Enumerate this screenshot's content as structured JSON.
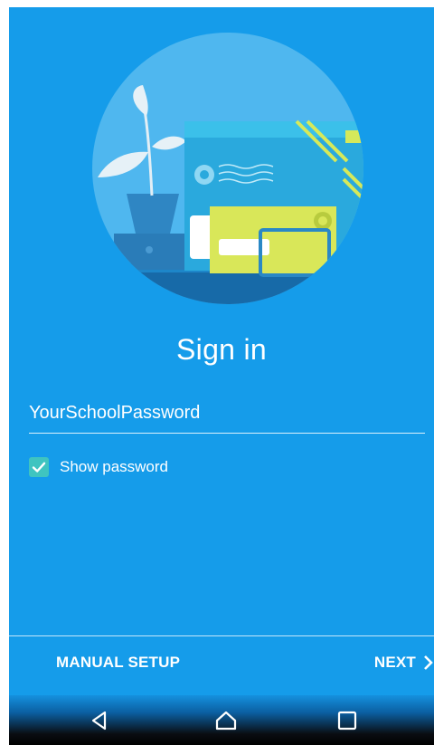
{
  "title": "Sign in",
  "password": {
    "value": "YourSchoolPassword"
  },
  "show_password": {
    "label": "Show password",
    "checked": true
  },
  "buttons": {
    "manual_setup": "MANUAL SETUP",
    "next": "NEXT"
  },
  "navbar": {
    "back": "back-icon",
    "home": "home-icon",
    "recent": "recent-apps-icon"
  },
  "colors": {
    "background": "#159cea",
    "checkbox": "#3fc4c0",
    "illustration_circle": "#4fb7ef"
  }
}
